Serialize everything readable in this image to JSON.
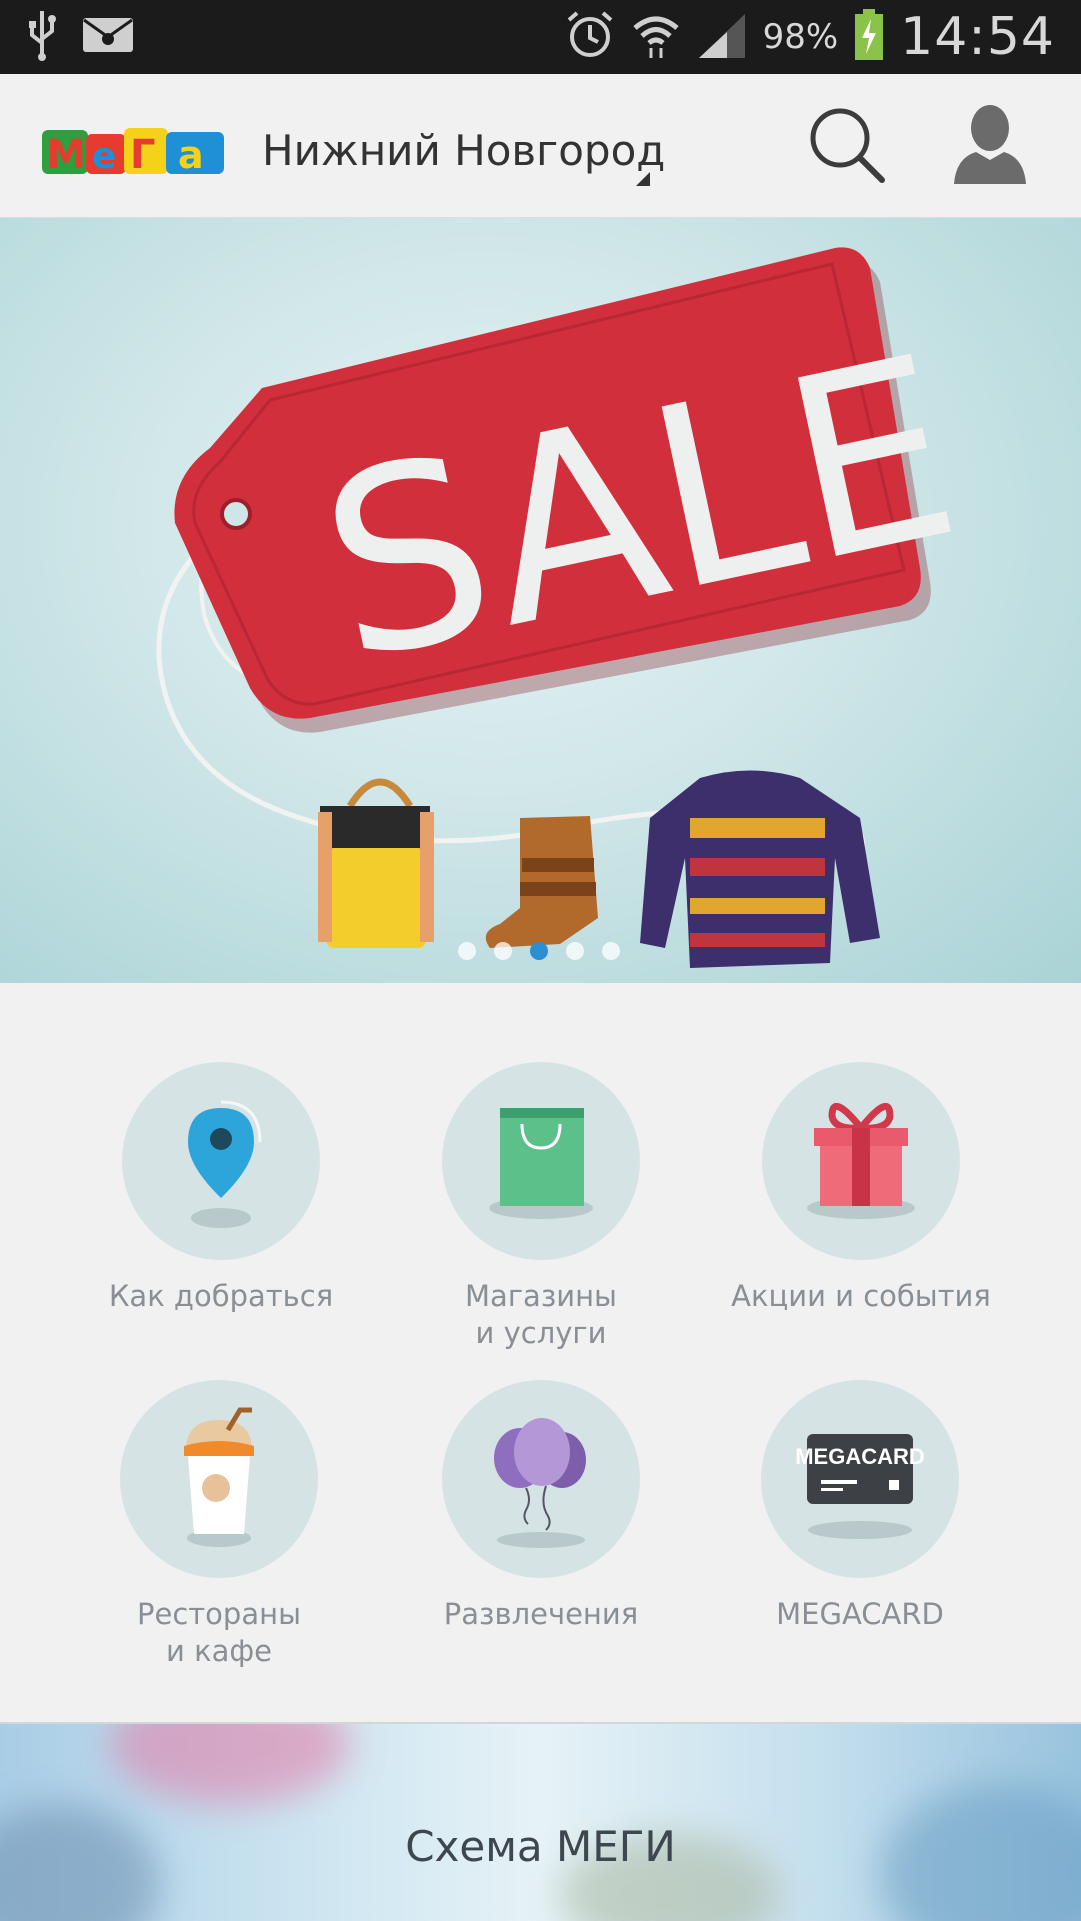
{
  "status_bar": {
    "battery_percent": "98%",
    "time": "14:54",
    "icons": [
      "usb-icon",
      "mail-icon",
      "alarm-icon",
      "wifi-icon",
      "signal-icon",
      "battery-icon"
    ]
  },
  "app_bar": {
    "logo_text": "МеГа",
    "city": "Нижний Новгород",
    "search_icon": "search-icon",
    "profile_icon": "user-icon"
  },
  "banner": {
    "tag_text": "SALE",
    "slide_count": 5,
    "active_slide": 3,
    "accent_color": "#d12f3c"
  },
  "tiles": [
    {
      "label": "Как добраться",
      "icon": "location-pin-icon"
    },
    {
      "label": "Магазины\nи услуги",
      "icon": "shopping-bag-icon"
    },
    {
      "label": "Акции и события",
      "icon": "gift-icon"
    },
    {
      "label": "Рестораны\nи кафе",
      "icon": "drink-cup-icon"
    },
    {
      "label": "Развлечения",
      "icon": "balloons-icon"
    },
    {
      "label": "MEGACARD",
      "icon": "megacard-icon",
      "card_text": "MEGACARD"
    }
  ],
  "map_banner": {
    "title": "Схема МЕГИ"
  }
}
